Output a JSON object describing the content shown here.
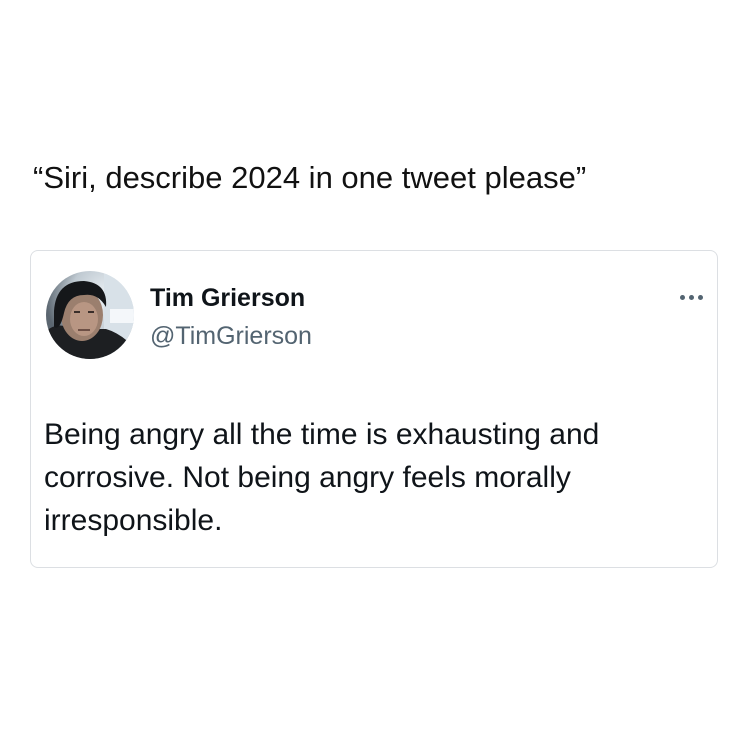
{
  "caption": "“Siri, describe 2024 in one tweet please”",
  "tweet": {
    "author_name": "Tim Grierson",
    "author_handle": "@TimGrierson",
    "more_icon": "more-horizontal-icon",
    "text_lines": [
      "Being angry all the time is exhausting and",
      "corrosive. Not being angry feels morally",
      "irresponsible."
    ]
  },
  "colors": {
    "text_primary": "#0f1419",
    "text_secondary": "#536471",
    "card_border": "#dcdfe3"
  }
}
